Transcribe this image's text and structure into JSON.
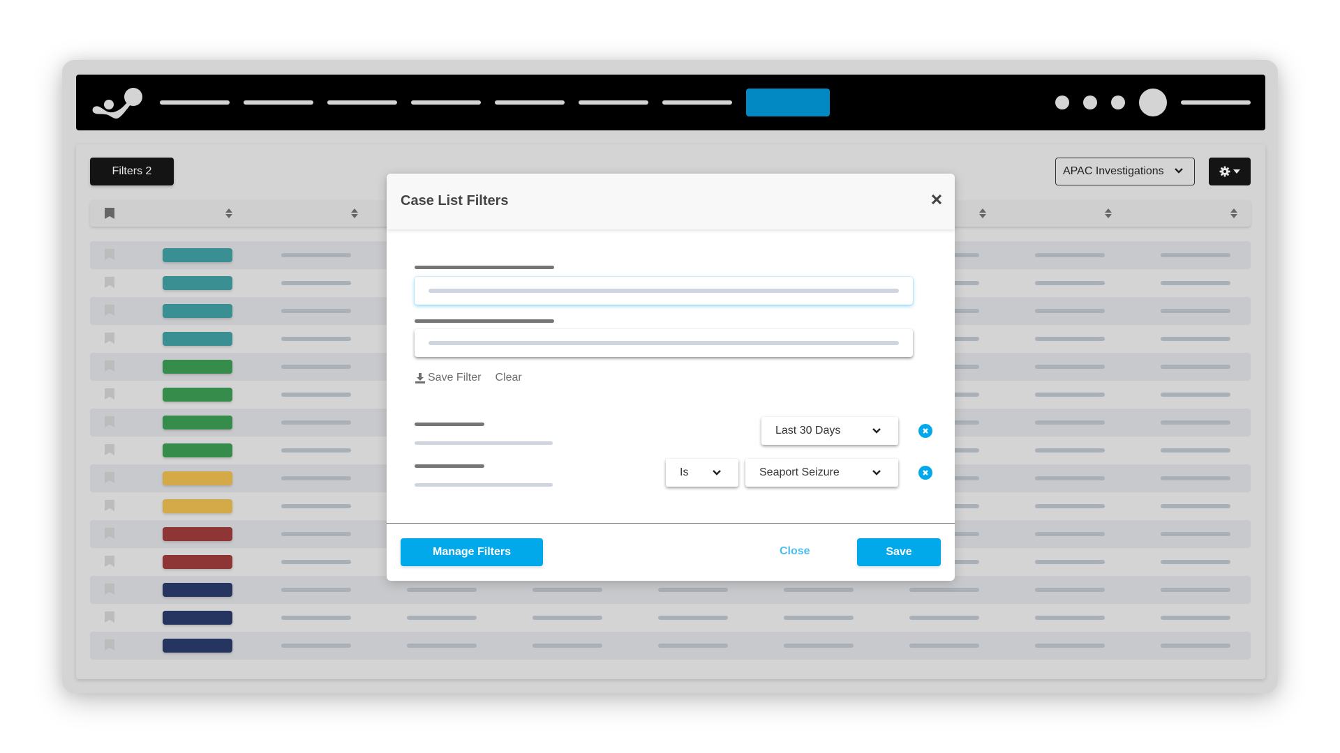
{
  "navbar": {
    "logo": "brand-logo",
    "link_count": 7,
    "has_cta": true,
    "icons": [
      "notification-dot",
      "notification-dot",
      "notification-dot"
    ]
  },
  "toolbar": {
    "filters_label": "Filters 2",
    "view_select_value": "APAC Investigations",
    "settings_icon": "gear-icon"
  },
  "table": {
    "header": {
      "bookmark_icon": "bookmark-icon",
      "sortable_columns": 9
    },
    "rows": [
      {
        "status_color": "#3a8f92"
      },
      {
        "status_color": "#3a8f92"
      },
      {
        "status_color": "#3a8f92"
      },
      {
        "status_color": "#3a8f92"
      },
      {
        "status_color": "#358c4b"
      },
      {
        "status_color": "#358c4b"
      },
      {
        "status_color": "#358c4b"
      },
      {
        "status_color": "#358c4b"
      },
      {
        "status_color": "#d4a947"
      },
      {
        "status_color": "#d4a947"
      },
      {
        "status_color": "#8e3636"
      },
      {
        "status_color": "#8e3636"
      },
      {
        "status_color": "#25355f"
      },
      {
        "status_color": "#25355f"
      },
      {
        "status_color": "#25355f"
      }
    ]
  },
  "modal": {
    "title": "Case List Filters",
    "save_filter_label": "Save Filter",
    "clear_label": "Clear",
    "criteria": [
      {
        "value": "Last 30 Days"
      },
      {
        "operator": "Is",
        "value": "Seaport Seizure"
      }
    ],
    "manage_filters_label": "Manage Filters",
    "close_label": "Close",
    "save_label": "Save"
  },
  "colors": {
    "accent": "#02a9ea",
    "navbar_cta": "#0289c3",
    "navbar_bg": "#000000"
  }
}
